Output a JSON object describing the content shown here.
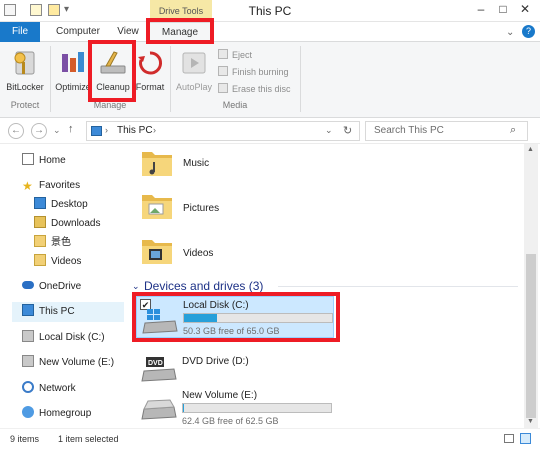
{
  "window": {
    "title": "This PC",
    "context_tab_group": "Drive Tools",
    "controls": [
      "minimize",
      "maximize",
      "close"
    ]
  },
  "ribbon_tabs": {
    "file": "File",
    "computer": "Computer",
    "view": "View",
    "manage": "Manage"
  },
  "ribbon": {
    "protect": {
      "bitlocker": "BitLocker",
      "group": "Protect"
    },
    "manage": {
      "optimize": "Optimize",
      "cleanup": "Cleanup",
      "format": "Format",
      "group": "Manage"
    },
    "media": {
      "autoplay": "AutoPlay",
      "eject": "Eject",
      "finish_burning": "Finish burning",
      "erase_disc": "Erase this disc",
      "group": "Media"
    }
  },
  "address": {
    "path": "This PC",
    "search_placeholder": "Search This PC"
  },
  "sidebar": {
    "home": "Home",
    "favorites": "Favorites",
    "desktop": "Desktop",
    "downloads": "Downloads",
    "chinese_folder": "景色",
    "videos": "Videos",
    "onedrive": "OneDrive",
    "this_pc": "This PC",
    "local_disk": "Local Disk (C:)",
    "new_volume": "New Volume (E:)",
    "network": "Network",
    "homegroup": "Homegroup"
  },
  "folders": [
    {
      "name": "Music",
      "icon": "music-folder-icon"
    },
    {
      "name": "Pictures",
      "icon": "pictures-folder-icon"
    },
    {
      "name": "Videos",
      "icon": "videos-folder-icon"
    }
  ],
  "devices_header": "Devices and drives (3)",
  "drives": {
    "c": {
      "name": "Local Disk (C:)",
      "free_text": "50.3 GB free of 65.0 GB",
      "free_gb": 50.3,
      "total_gb": 65.0,
      "used_fraction": 0.226,
      "selected": true
    },
    "d": {
      "name": "DVD Drive (D:)"
    },
    "e": {
      "name": "New Volume (E:)",
      "free_text": "62.4 GB free of 62.5 GB",
      "free_gb": 62.4,
      "total_gb": 62.5,
      "used_fraction": 0.002
    }
  },
  "status": {
    "items": "9 items",
    "selected": "1 item selected"
  },
  "colors": {
    "accent": "#1979ca",
    "highlight": "#ee1c25",
    "context_tab": "#f6e8a6",
    "bar_fill": "#26a0da",
    "section_header": "#1e3287"
  }
}
